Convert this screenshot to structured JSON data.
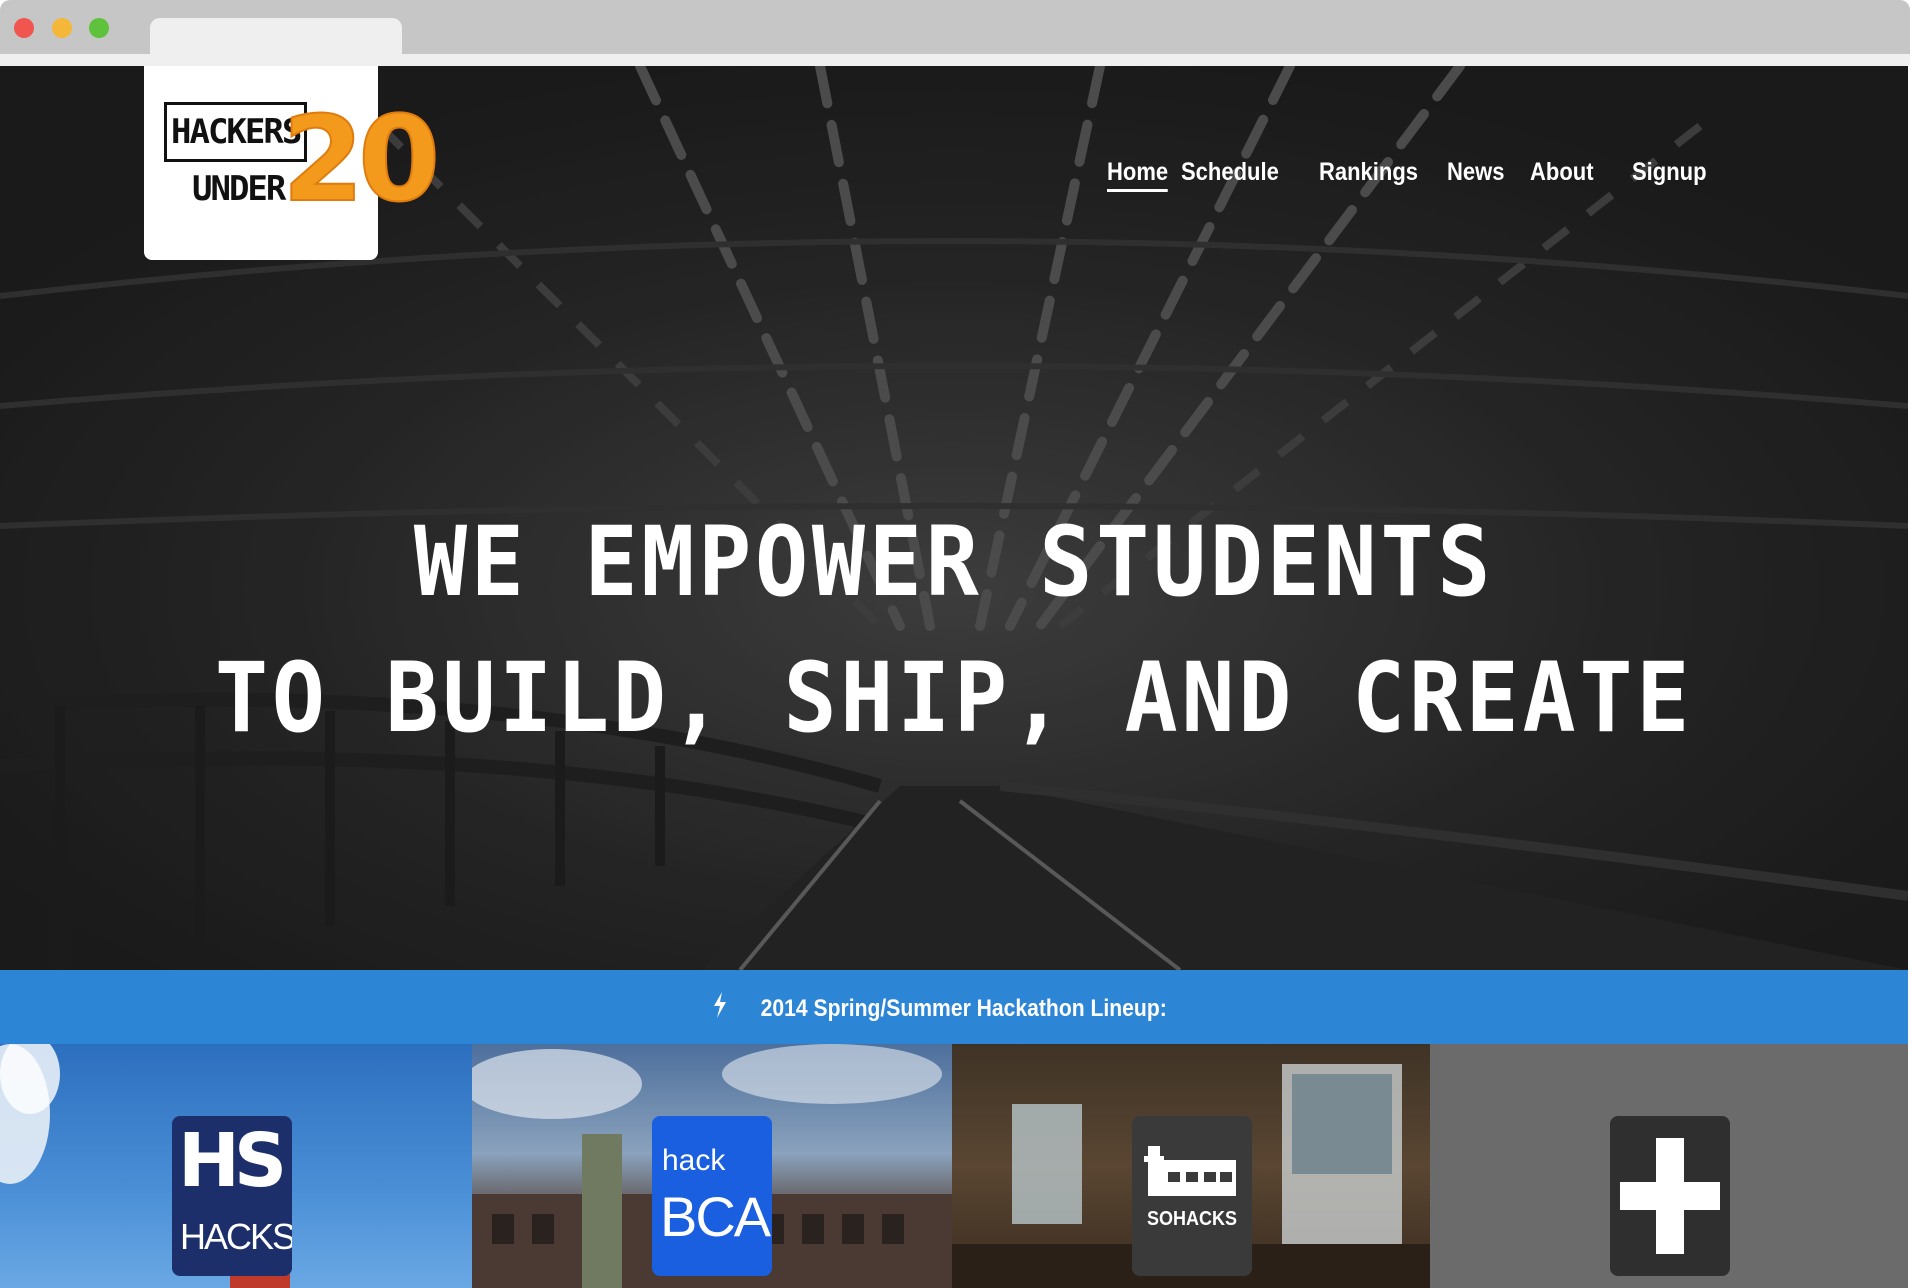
{
  "browser": {
    "tab_title": ""
  },
  "header": {
    "logo": {
      "words": [
        "HACKERS",
        "UNDER"
      ],
      "number": "20"
    },
    "nav": [
      {
        "label": "Home",
        "active": true
      },
      {
        "label": "Schedule",
        "active": false
      },
      {
        "label": "Rankings",
        "active": false
      },
      {
        "label": "News",
        "active": false
      },
      {
        "label": "About",
        "active": false
      },
      {
        "label": "Signup",
        "active": false
      }
    ]
  },
  "hero": {
    "line1": "WE EMPOWER STUDENTS",
    "line2": "TO BUILD, SHIP, AND CREATE"
  },
  "lineup": {
    "icon": "bolt-icon",
    "title": "2014 Spring/Summer Hackathon Lineup:"
  },
  "tiles": [
    {
      "name": "hshacks",
      "logo_big": "HS",
      "logo_small": "HACKS"
    },
    {
      "name": "hackbca",
      "logo_top": "hack",
      "logo_big": "BCA"
    },
    {
      "name": "sohacks",
      "logo_label": "SOHACKS",
      "icon": "building-icon"
    },
    {
      "name": "add",
      "icon": "plus-icon"
    }
  ],
  "colors": {
    "accent_blue": "#2d85d6",
    "logo_orange": "#f39a1c",
    "hero_bg": "#2e2e2e"
  }
}
